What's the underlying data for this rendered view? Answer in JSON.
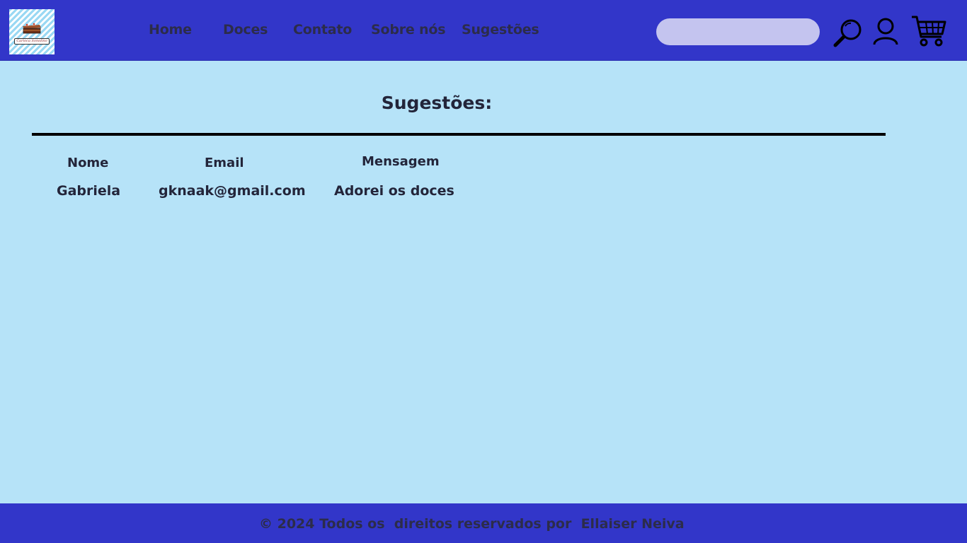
{
  "brand": {
    "logo_text": "Carioca Sonolino"
  },
  "nav": {
    "items": [
      {
        "label": "Home"
      },
      {
        "label": "Doces"
      },
      {
        "label": "Contato"
      },
      {
        "label": "Sobre nós"
      },
      {
        "label": "Sugestões"
      }
    ]
  },
  "search": {
    "value": "",
    "placeholder": ""
  },
  "icons": {
    "search": "search-icon",
    "user": "user-icon",
    "cart": "cart-icon"
  },
  "colors": {
    "header_bg": "#3236c9",
    "page_bg": "#b6e3f8",
    "search_bg": "#c4c4ef",
    "text": "#23253a"
  },
  "page": {
    "title": "Sugestões:"
  },
  "table": {
    "headers": [
      "Nome",
      "Email",
      "Mensagem"
    ],
    "rows": [
      [
        "Gabriela",
        "gknaak@gmail.com",
        "Adorei os doces"
      ]
    ]
  },
  "footer": {
    "text": "© 2024 Todos os  direitos reservados por  Ellaiser Neiva"
  }
}
